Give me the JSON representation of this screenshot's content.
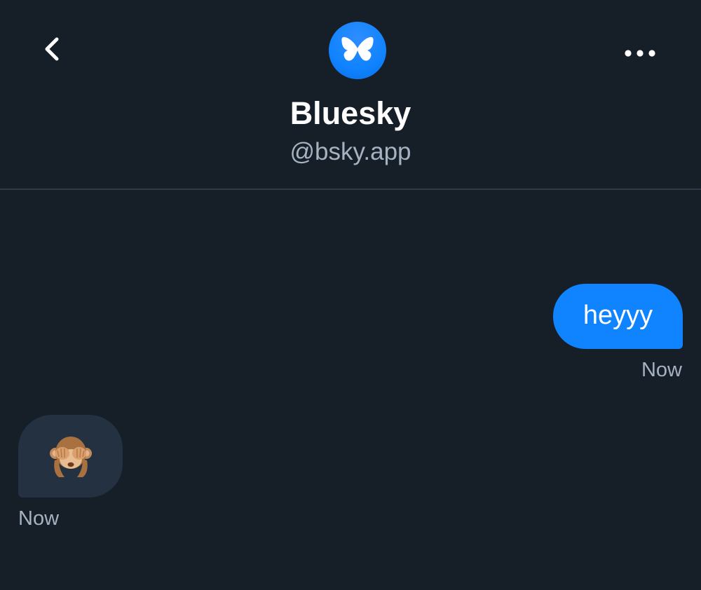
{
  "header": {
    "display_name": "Bluesky",
    "handle": "@bsky.app",
    "back_icon": "chevron-left-icon",
    "more_icon": "ellipsis-horizontal-icon",
    "avatar_icon": "butterfly-logo-icon"
  },
  "messages": [
    {
      "direction": "outgoing",
      "text": "heyyy",
      "time": "Now"
    },
    {
      "direction": "incoming",
      "emoji": "see-no-evil-monkey",
      "time": "Now"
    }
  ],
  "colors": {
    "background": "#161e27",
    "outgoing_bubble": "#1083fe",
    "incoming_bubble": "#243141",
    "secondary_text": "#a4b2c2",
    "divider": "#2e3a48",
    "accent": "#1083fe"
  }
}
